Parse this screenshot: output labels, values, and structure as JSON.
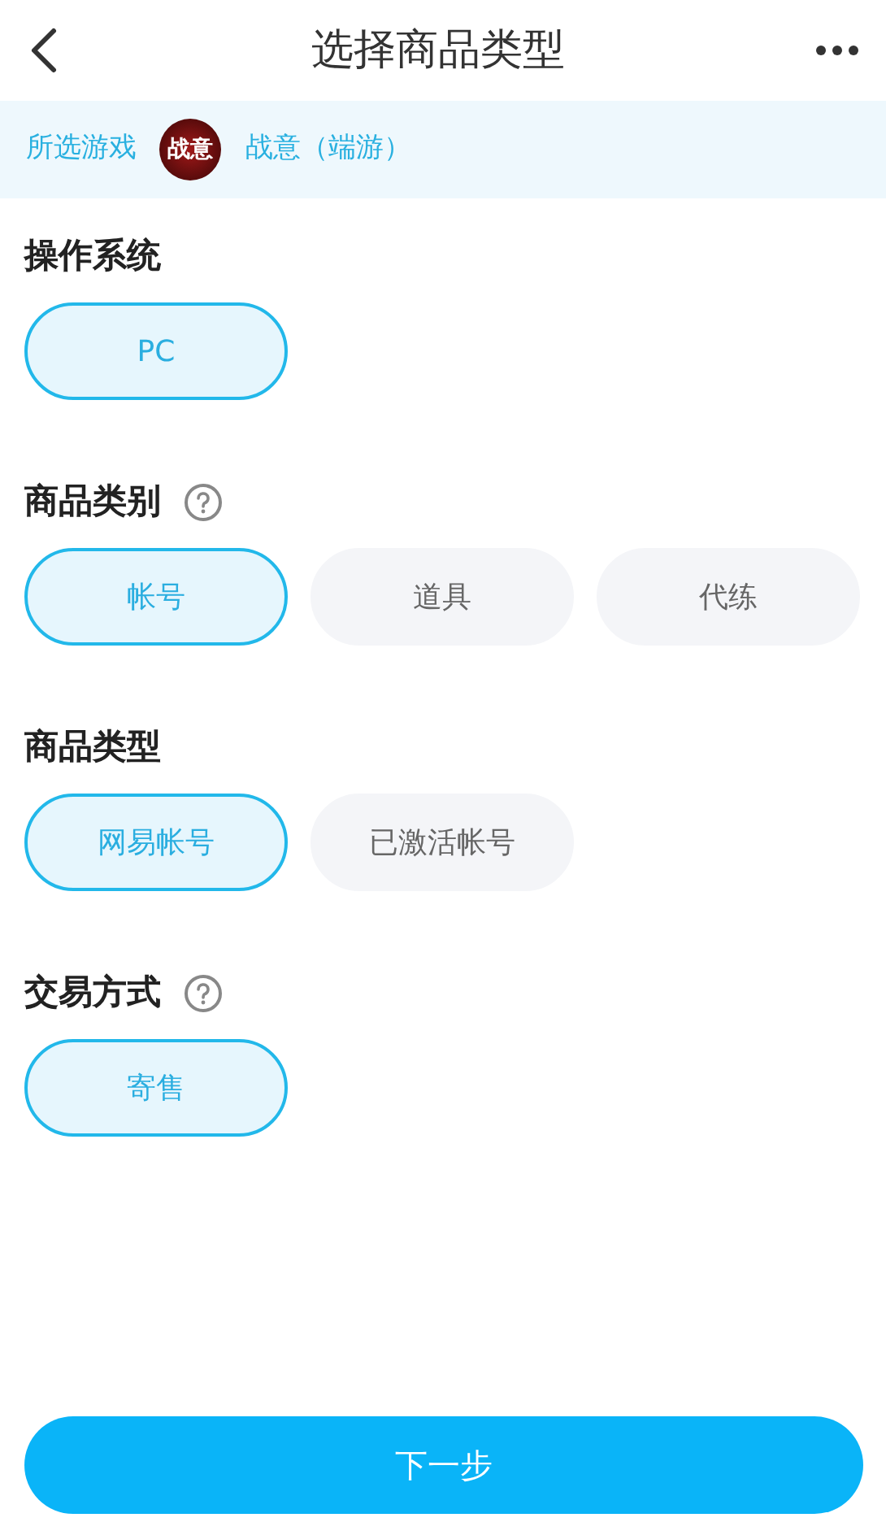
{
  "header": {
    "title": "选择商品类型"
  },
  "game": {
    "label": "所选游戏",
    "logo_text": "战意",
    "name": "战意（端游）"
  },
  "sections": [
    {
      "title": "操作系统",
      "help": false,
      "options": [
        {
          "label": "PC",
          "selected": true
        }
      ]
    },
    {
      "title": "商品类别",
      "help": true,
      "options": [
        {
          "label": "帐号",
          "selected": true
        },
        {
          "label": "道具",
          "selected": false
        },
        {
          "label": "代练",
          "selected": false
        }
      ]
    },
    {
      "title": "商品类型",
      "help": false,
      "options": [
        {
          "label": "网易帐号",
          "selected": true
        },
        {
          "label": "已激活帐号",
          "selected": false
        }
      ]
    },
    {
      "title": "交易方式",
      "help": true,
      "options": [
        {
          "label": "寄售",
          "selected": true
        }
      ]
    }
  ],
  "next_button": "下一步"
}
